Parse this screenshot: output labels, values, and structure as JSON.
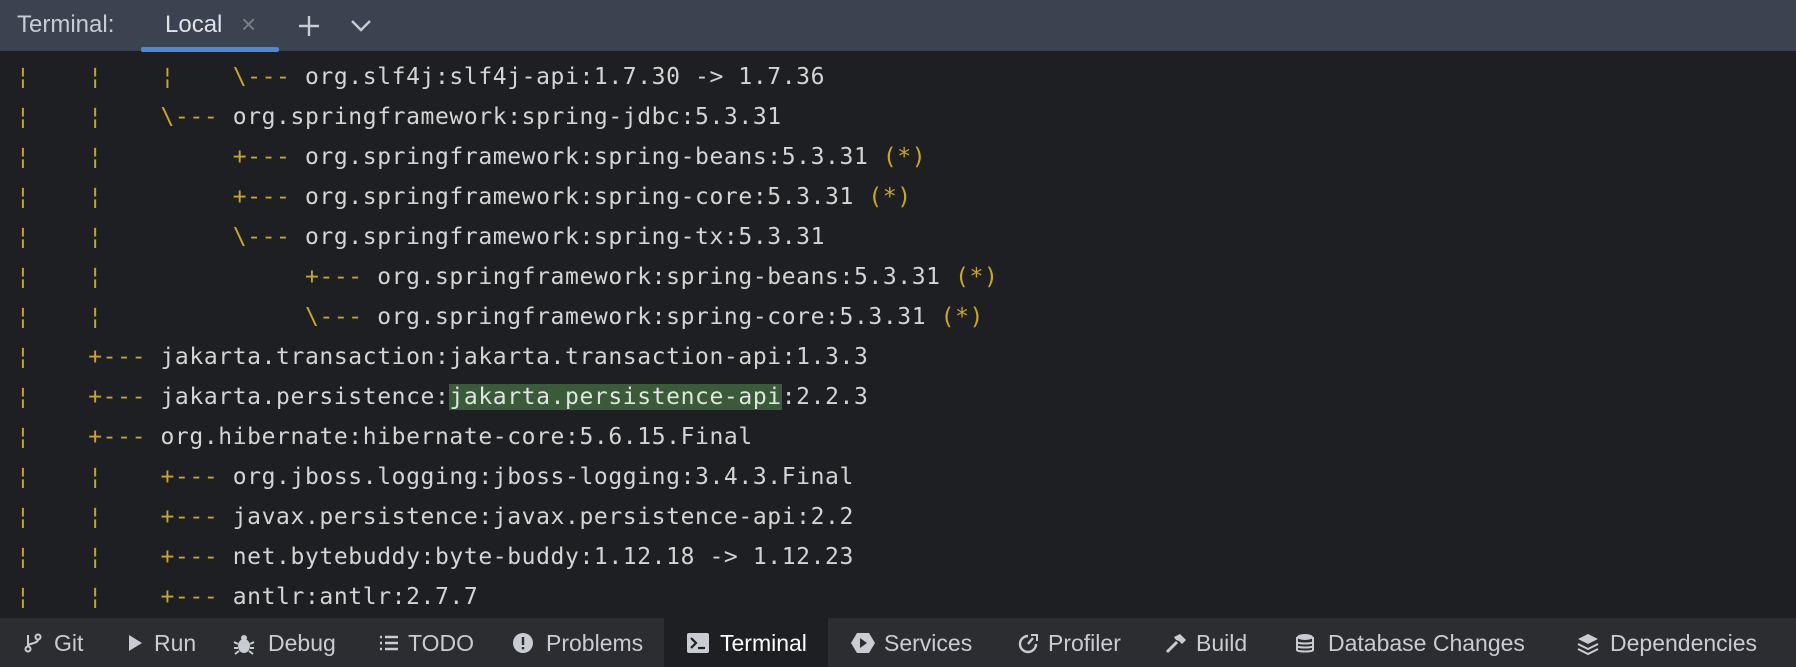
{
  "header": {
    "title": "Terminal:",
    "tab_label": "Local",
    "close_glyph": "×",
    "add_icon": "plus-icon",
    "dropdown_icon": "chevron-down-icon"
  },
  "terminal": {
    "lines": [
      {
        "tree": "¦    ¦    ¦    \\--- ",
        "text": "org.slf4j:slf4j-api:1.7.30 -> 1.7.36",
        "mark": ""
      },
      {
        "tree": "¦    ¦    \\--- ",
        "text": "org.springframework:spring-jdbc:5.3.31",
        "mark": ""
      },
      {
        "tree": "¦    ¦         +--- ",
        "text": "org.springframework:spring-beans:5.3.31 ",
        "mark": "(*)"
      },
      {
        "tree": "¦    ¦         +--- ",
        "text": "org.springframework:spring-core:5.3.31 ",
        "mark": "(*)"
      },
      {
        "tree": "¦    ¦         \\--- ",
        "text": "org.springframework:spring-tx:5.3.31",
        "mark": ""
      },
      {
        "tree": "¦    ¦              +--- ",
        "text": "org.springframework:spring-beans:5.3.31 ",
        "mark": "(*)"
      },
      {
        "tree": "¦    ¦              \\--- ",
        "text": "org.springframework:spring-core:5.3.31 ",
        "mark": "(*)"
      },
      {
        "tree": "¦    +--- ",
        "text": "jakarta.transaction:jakarta.transaction-api:1.3.3",
        "mark": ""
      },
      {
        "tree": "¦    +--- ",
        "text_before": "jakarta.persistence:",
        "text_highlight": "jakarta.persistence-api",
        "text_after": ":2.2.3"
      },
      {
        "tree": "¦    +--- ",
        "text": "org.hibernate:hibernate-core:5.6.15.Final",
        "mark": ""
      },
      {
        "tree": "¦    ¦    +--- ",
        "text": "org.jboss.logging:jboss-logging:3.4.3.Final",
        "mark": ""
      },
      {
        "tree": "¦    ¦    +--- ",
        "text": "javax.persistence:javax.persistence-api:2.2",
        "mark": ""
      },
      {
        "tree": "¦    ¦    +--- ",
        "text": "net.bytebuddy:byte-buddy:1.12.18 -> 1.12.23",
        "mark": ""
      },
      {
        "tree": "¦    ¦    +--- ",
        "text": "antlr:antlr:2.7.7",
        "mark": ""
      }
    ]
  },
  "statusbar": {
    "items": [
      {
        "label": "Git",
        "icon": "git-branch-icon"
      },
      {
        "label": "Run",
        "icon": "run-icon"
      },
      {
        "label": "Debug",
        "icon": "bug-icon"
      },
      {
        "label": "TODO",
        "icon": "list-icon"
      },
      {
        "label": "Problems",
        "icon": "problems-icon"
      },
      {
        "label": "Terminal",
        "icon": "terminal-icon"
      },
      {
        "label": "Services",
        "icon": "services-icon"
      },
      {
        "label": "Profiler",
        "icon": "profiler-icon"
      },
      {
        "label": "Build",
        "icon": "hammer-icon"
      },
      {
        "label": "Database Changes",
        "icon": "database-icon"
      },
      {
        "label": "Dependencies",
        "icon": "layers-icon"
      }
    ],
    "active": "Terminal"
  },
  "colors": {
    "tree_branch": "#c8a628",
    "highlight": "#3a5a3a",
    "accent": "#4a88d8"
  }
}
